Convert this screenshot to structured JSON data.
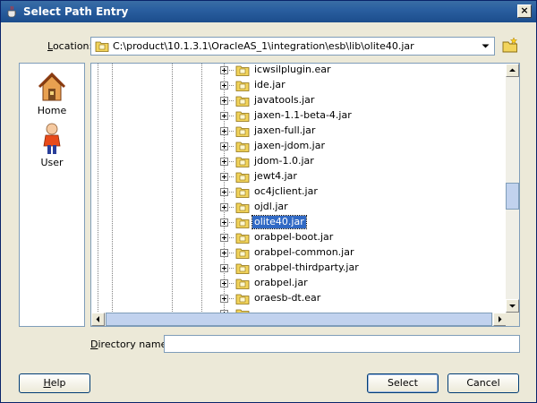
{
  "window": {
    "title": "Select Path Entry",
    "close_glyph": "×"
  },
  "location": {
    "label_prefix": "",
    "label_underlined": "L",
    "label_rest": "ocation:",
    "path": "C:\\product\\10.1.3.1\\OracleAS_1\\integration\\esb\\lib\\olite40.jar"
  },
  "shortcuts": [
    {
      "label": "Home",
      "icon": "home-icon"
    },
    {
      "label": "User",
      "icon": "user-icon"
    }
  ],
  "tree": {
    "items": [
      {
        "label": "icwsilplugin.ear",
        "selected": false
      },
      {
        "label": "ide.jar",
        "selected": false
      },
      {
        "label": "javatools.jar",
        "selected": false
      },
      {
        "label": "jaxen-1.1-beta-4.jar",
        "selected": false
      },
      {
        "label": "jaxen-full.jar",
        "selected": false
      },
      {
        "label": "jaxen-jdom.jar",
        "selected": false
      },
      {
        "label": "jdom-1.0.jar",
        "selected": false
      },
      {
        "label": "jewt4.jar",
        "selected": false
      },
      {
        "label": "oc4jclient.jar",
        "selected": false
      },
      {
        "label": "ojdl.jar",
        "selected": false
      },
      {
        "label": "olite40.jar",
        "selected": true
      },
      {
        "label": "orabpel-boot.jar",
        "selected": false
      },
      {
        "label": "orabpel-common.jar",
        "selected": false
      },
      {
        "label": "orabpel-thirdparty.jar",
        "selected": false
      },
      {
        "label": "orabpel.jar",
        "selected": false
      },
      {
        "label": "oraesb-dt.ear",
        "selected": false
      }
    ],
    "vscroll_fraction": 0.54
  },
  "directory": {
    "label_underlined": "D",
    "label_rest": "irectory name:",
    "value": ""
  },
  "buttons": {
    "help_underlined": "H",
    "help_rest": "elp",
    "select": "Select",
    "cancel": "Cancel"
  },
  "colors": {
    "titlebar": "#2a5fa0",
    "selection": "#316ac5",
    "folder_yellow": "#f2d45c"
  }
}
